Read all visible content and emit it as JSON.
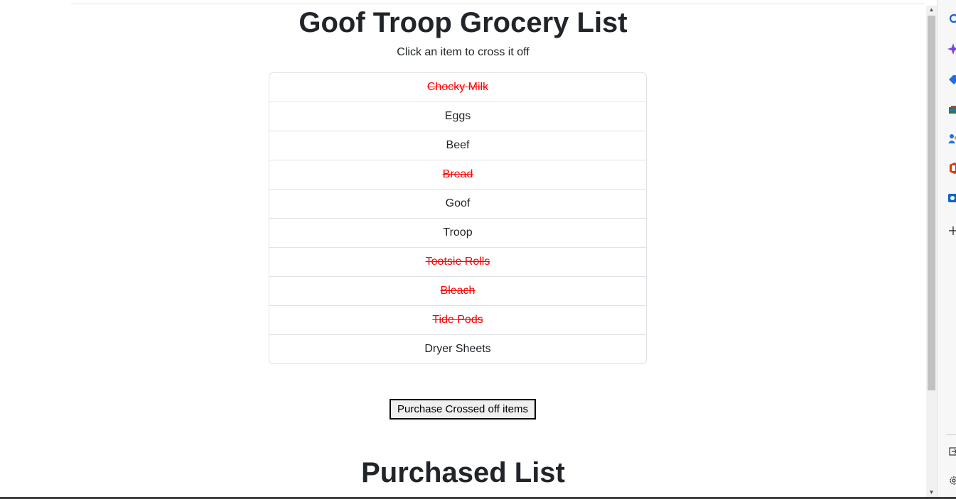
{
  "page": {
    "title": "Goof Troop Grocery List",
    "subtitle": "Click an item to cross it off"
  },
  "items": [
    {
      "label": "Chocky Milk",
      "crossed": true
    },
    {
      "label": "Eggs",
      "crossed": false
    },
    {
      "label": "Beef",
      "crossed": false
    },
    {
      "label": "Bread",
      "crossed": true
    },
    {
      "label": "Goof",
      "crossed": false
    },
    {
      "label": "Troop",
      "crossed": false
    },
    {
      "label": "Tootsie Rolls",
      "crossed": true
    },
    {
      "label": "Bleach",
      "crossed": true
    },
    {
      "label": "Tide Pods",
      "crossed": true
    },
    {
      "label": "Dryer Sheets",
      "crossed": false
    }
  ],
  "purchase_button": {
    "label": "Purchase Crossed off items"
  },
  "purchased": {
    "title": "Purchased List"
  },
  "colors": {
    "crossed": "#ff0000",
    "text": "#212529",
    "border": "#dee2e6"
  },
  "sidebar_icons": [
    "search-icon",
    "copilot-sparkle-icon",
    "tag-icon",
    "toolbox-icon",
    "people-icon",
    "office-icon",
    "outlook-icon",
    "add-icon",
    "exit-icon",
    "settings-icon"
  ]
}
